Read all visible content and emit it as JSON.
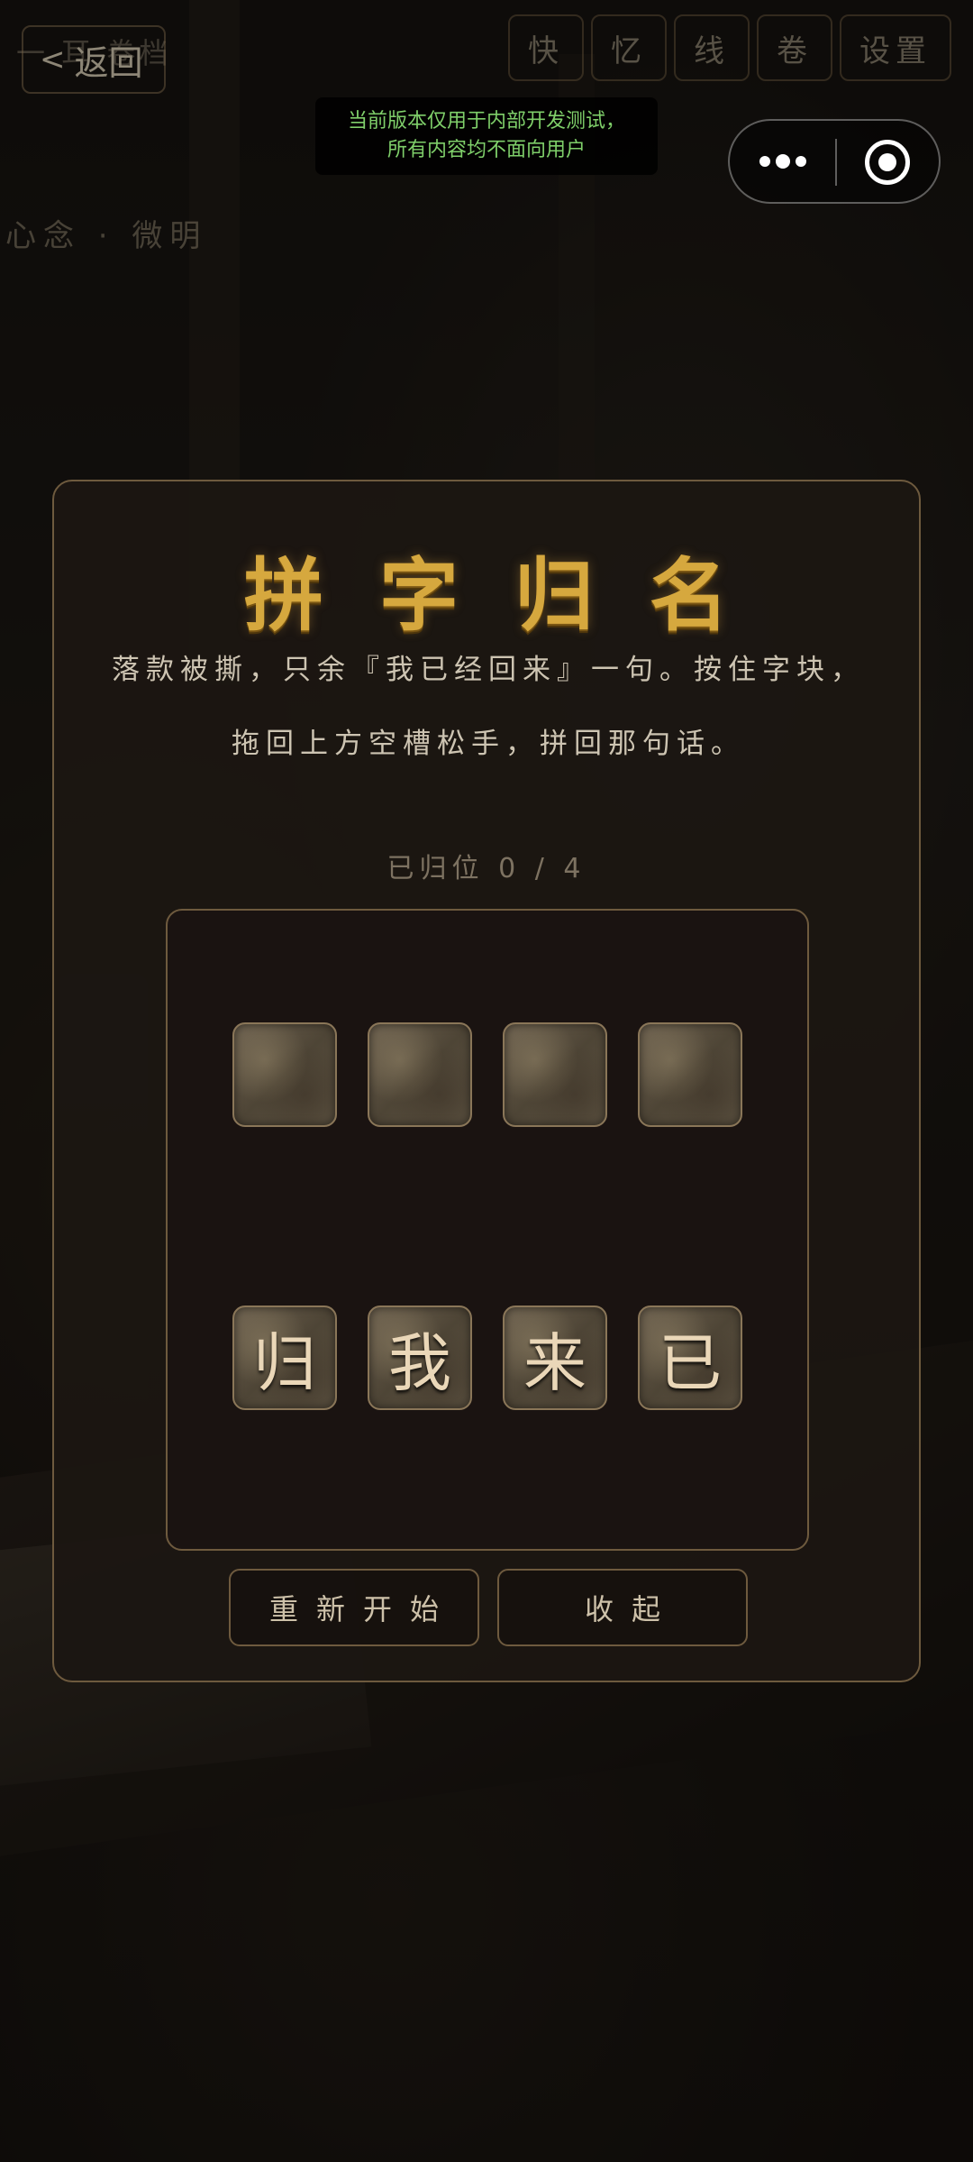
{
  "header": {
    "back_label": "返回",
    "crumb": "一 耳 卷档",
    "nav": [
      "快",
      "忆",
      "线",
      "卷",
      "设置"
    ],
    "mind_status": "心念 · 微明"
  },
  "dev_notice": {
    "line1": "当前版本仅用于内部开发测试，",
    "line2": "所有内容均不面向用户"
  },
  "puzzle": {
    "title": "拼字归名",
    "description": "落款被撕，只余『我已经回来』一句。按住字块，拖回上方空槽松手，拼回那句话。",
    "progress": "已归位 0 / 4",
    "slot_count": 4,
    "tiles": [
      "归",
      "我",
      "来",
      "已"
    ],
    "restart_label": "重新开始",
    "collapse_label": "收起"
  }
}
